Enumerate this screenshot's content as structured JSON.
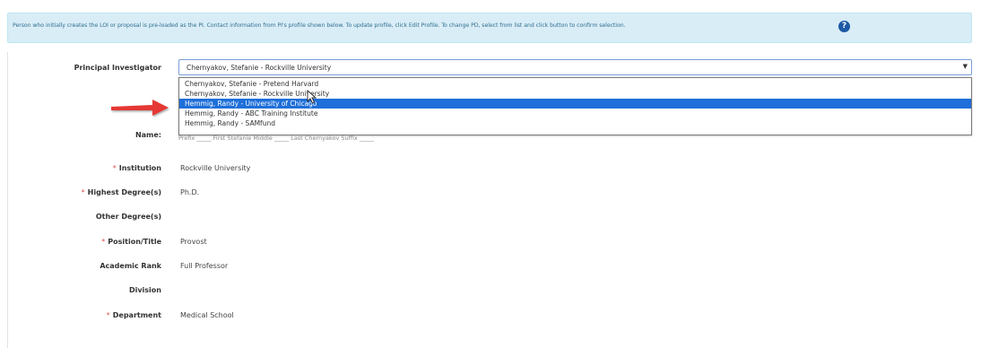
{
  "info": {
    "text": "Person who initially creates the LOI or proposal is pre-loaded as the PI. Contact information from PI's profile shown below. To update profile, click Edit Profile. To change PD, select from list and click button to confirm selection.",
    "help_icon": "?"
  },
  "principal_investigator": {
    "label": "Principal Investigator",
    "selected": "Chernyakov, Stefanie - Rockville University",
    "caret": "▼",
    "options": [
      "Chernyakov, Stefanie - Pretend Harvard",
      "Chernyakov, Stefanie - Rockville University",
      "Hemmig, Randy - University of Chicago",
      "Hemmig, Randy - ABC Training Institute",
      "Hemmig, Randy - SAMfund"
    ],
    "highlighted_index": 2
  },
  "fields": {
    "name_label": "Name:",
    "name_sub": "Prefix _____   First Stefanie   Middle _____   Last Chernyakov   Suffix _____",
    "required_marker": "*",
    "institution_label": "Institution",
    "institution_value": "Rockville University",
    "highest_degree_label": "Highest Degree(s)",
    "highest_degree_value": "Ph.D.",
    "other_degree_label": "Other Degree(s)",
    "position_label": "Position/Title",
    "position_value": "Provost",
    "academic_rank_label": "Academic Rank",
    "academic_rank_value": "Full Professor",
    "division_label": "Division",
    "department_label": "Department",
    "department_value": "Medical School"
  },
  "colors": {
    "info_bg": "#d9edf7",
    "info_text": "#31708f",
    "selection": "#1e6fd9",
    "required": "#d9534f",
    "arrow": "#e53935"
  }
}
